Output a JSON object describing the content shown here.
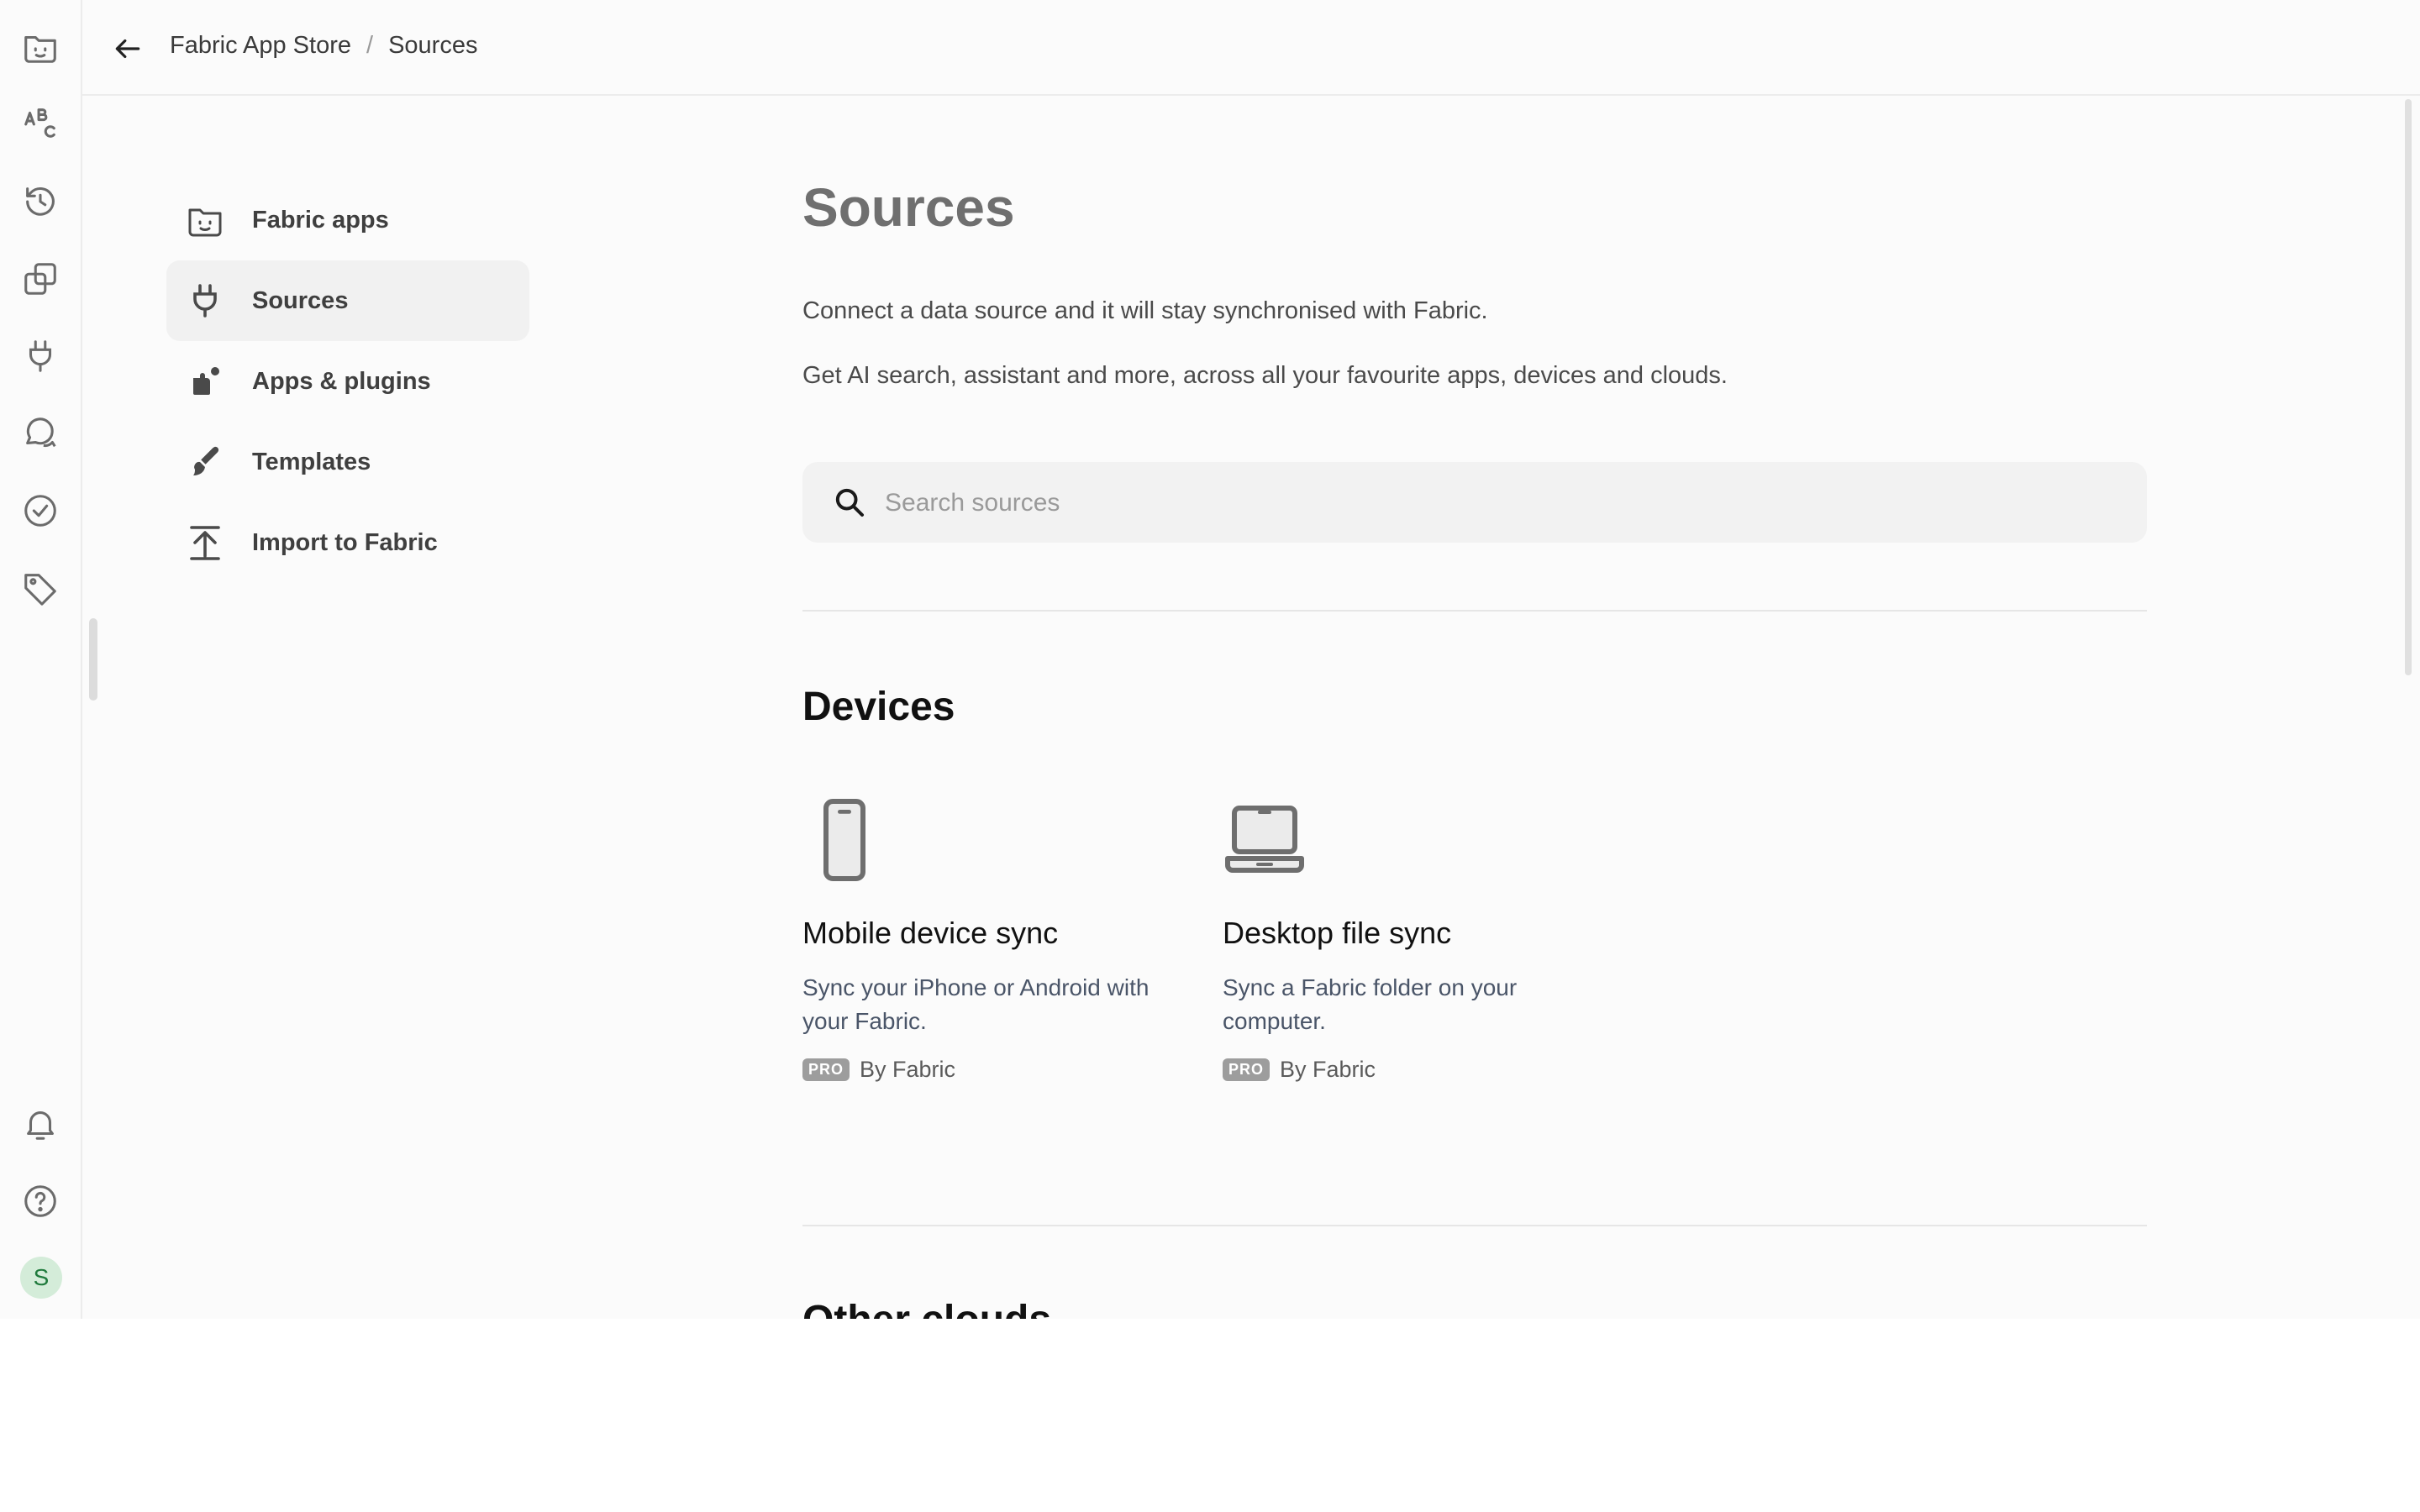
{
  "rail": {
    "icons": [
      "fabric-logo-icon",
      "text-abc-icon",
      "history-icon",
      "copy-icon",
      "plug-icon",
      "chat-icon",
      "check-circle-icon",
      "tag-icon"
    ],
    "bottom_icons": [
      "bell-icon",
      "help-icon"
    ],
    "avatar_letter": "S"
  },
  "breadcrumb": {
    "root": "Fabric App Store",
    "separator": "/",
    "current": "Sources"
  },
  "nav": {
    "items": [
      {
        "label": "Fabric apps",
        "icon": "fabric-folder-icon"
      },
      {
        "label": "Sources",
        "icon": "plug-icon",
        "active": true
      },
      {
        "label": "Apps & plugins",
        "icon": "apps-plugins-icon"
      },
      {
        "label": "Templates",
        "icon": "brush-icon"
      },
      {
        "label": "Import to Fabric",
        "icon": "upload-icon"
      }
    ]
  },
  "main": {
    "title": "Sources",
    "desc1": "Connect a data source and it will stay synchronised with Fabric.",
    "desc2": "Get AI search, assistant and more, across all your favourite apps, devices and clouds.",
    "search_placeholder": "Search sources",
    "devices_heading": "Devices",
    "cards": [
      {
        "title": "Mobile device sync",
        "desc": "Sync your iPhone or Android with your Fabric.",
        "badge": "PRO",
        "by": "By Fabric",
        "icon": "phone-icon"
      },
      {
        "title": "Desktop file sync",
        "desc": "Sync a Fabric folder on your computer.",
        "badge": "PRO",
        "by": "By Fabric",
        "icon": "laptop-icon"
      }
    ],
    "next_heading": "Other clouds"
  }
}
